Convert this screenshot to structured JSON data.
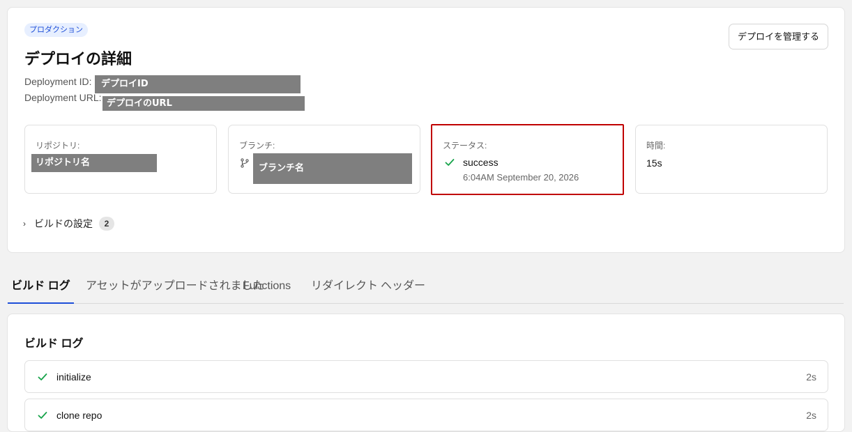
{
  "header": {
    "environment_badge": "プロダクション",
    "title": "デプロイの詳細",
    "manage_button": "デプロイを管理する"
  },
  "meta": {
    "id_label": "Deployment ID:",
    "id_value": "デプロイID",
    "url_label": "Deployment URL:",
    "url_value": "デプロイのURL"
  },
  "cards": {
    "repository": {
      "label": "リポジトリ:",
      "value": "リポジトリ名"
    },
    "branch": {
      "label": "ブランチ:",
      "value": "ブランチ名",
      "icon": "git-branch-icon"
    },
    "status": {
      "label": "ステータス:",
      "value": "success",
      "timestamp": "6:04AM September 20, 2026",
      "icon": "check-icon",
      "color": "#16a34a"
    },
    "duration": {
      "label": "時間:",
      "value": "15s"
    }
  },
  "build_settings": {
    "label": "ビルドの設定",
    "count": "2"
  },
  "tabs": [
    {
      "label": "ビルド ログ",
      "active": true
    },
    {
      "label": "アセットがアップロードされました",
      "active": false
    },
    {
      "label": "Functions",
      "active": false
    },
    {
      "label": "リダイレクト",
      "active": false
    },
    {
      "label": "ヘッダー",
      "active": false
    }
  ],
  "build_log": {
    "title": "ビルド ログ",
    "steps": [
      {
        "name": "initialize",
        "duration": "2s"
      },
      {
        "name": "clone repo",
        "duration": "2s"
      }
    ]
  },
  "colors": {
    "accent": "#1d4ed8",
    "success": "#16a34a",
    "highlight_border": "#c00000",
    "redaction": "#7f7f7f"
  }
}
